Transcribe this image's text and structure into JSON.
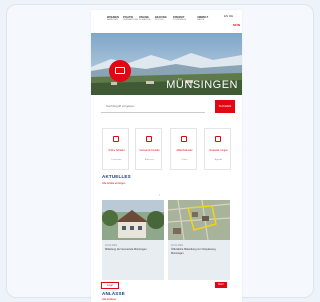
{
  "site": {
    "nav": [
      {
        "label": "WOHNEN",
        "sub": "ARBEITEN"
      },
      {
        "label": "POLITIK",
        "sub": "VERWALTUNG"
      },
      {
        "label": "ONLINE",
        "sub": "SCHALTER"
      },
      {
        "label": "BILDUNG",
        "sub": "KULTUR"
      },
      {
        "label": "FREIZEIT",
        "sub": "TOURISMUS"
      },
      {
        "label": "UMWELT",
        "sub": "NATUR"
      }
    ],
    "utility": "EN  DE",
    "logo": "MÜN",
    "hero_title": "MÜNSINGEN",
    "search": {
      "placeholder": "Suchbegriff eingeben",
      "button": "SUCHEN"
    },
    "tiles": [
      {
        "label": "Online Schalter",
        "sub": "Formulare"
      },
      {
        "label": "Gemeinde Kontakt",
        "sub": "Adressen"
      },
      {
        "label": "Abfall Kalender",
        "sub": "Daten"
      },
      {
        "label": "Veranstal- tungen",
        "sub": "Agenda"
      }
    ],
    "news_title": "AKTUELLES",
    "news_link": "Alle Artikel anzeigen",
    "news": [
      {
        "date": "01.01.2024",
        "text": "Mitteilung der Gemeinde Münsingen"
      },
      {
        "date": "01.01.2024",
        "text": "Öffentliche Mitwirkung zur Ortsplanung Münsingen"
      }
    ],
    "bottom_logo": "Logo",
    "bottom_button": "Mehr",
    "events_title": "ANLÄSSE",
    "events_link": "Alle Anlässe"
  },
  "colors": {
    "accent": "#e30613",
    "heading": "#1a3a7a",
    "background": "#eef3fa"
  }
}
